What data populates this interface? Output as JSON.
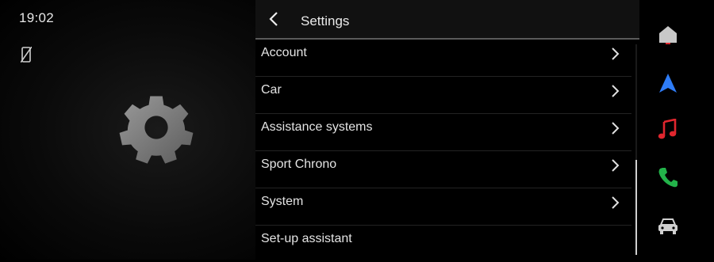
{
  "status": {
    "time": "19:02",
    "phone_icon": "phone-crossed-icon"
  },
  "hero": {
    "icon": "settings-gear-icon"
  },
  "header": {
    "title": "Settings",
    "back_icon": "chevron-left-icon"
  },
  "menu": [
    {
      "label": "Account",
      "has_arrow": true
    },
    {
      "label": "Car",
      "has_arrow": true
    },
    {
      "label": "Assistance systems",
      "has_arrow": true
    },
    {
      "label": "Sport Chrono",
      "has_arrow": true
    },
    {
      "label": "System",
      "has_arrow": true
    },
    {
      "label": "Set-up assistant",
      "has_arrow": false
    }
  ],
  "scroll": {
    "position_fraction": 0.55
  },
  "dock": [
    {
      "icon": "home-icon",
      "color": "#c8c8c8"
    },
    {
      "icon": "navigation-arrow-icon",
      "color": "#2e7cf6"
    },
    {
      "icon": "music-note-icon",
      "color": "#e0262e"
    },
    {
      "icon": "phone-call-icon",
      "color": "#23b34a"
    },
    {
      "icon": "car-icon",
      "color": "#d0d0d0"
    }
  ]
}
